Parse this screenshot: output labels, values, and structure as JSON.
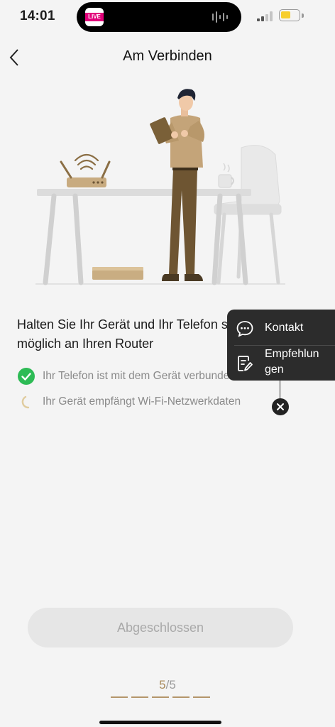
{
  "status_bar": {
    "time": "14:01",
    "island_app": "LIVE",
    "battery_color": "#f7ce2d"
  },
  "nav": {
    "back_icon": "chevron-left-icon",
    "title": "Am Verbinden"
  },
  "illustration": {
    "description_icon": "person-router-illustration"
  },
  "message": {
    "instruction": "Halten Sie Ihr Gerät und Ihr Telefon so nah wie möglich an Ihren Router",
    "steps": [
      {
        "label": "Ihr Telefon ist mit dem Gerät verbunden",
        "state": "done",
        "icon": "check-circle-icon"
      },
      {
        "label": "Ihr Gerät empfängt Wi-Fi-Netzwerkdaten",
        "state": "loading",
        "icon": "spinner-icon"
      }
    ]
  },
  "float_menu": {
    "items": [
      {
        "label": "Kontakt",
        "icon": "chat-bubble-icon"
      },
      {
        "label": "Empfehlungen",
        "label_lines": [
          "Empfehlun",
          "gen"
        ],
        "icon": "feedback-edit-icon"
      }
    ],
    "close_icon": "close-icon"
  },
  "actions": {
    "done_label": "Abgeschlossen"
  },
  "progress": {
    "current": "5",
    "separator": "/",
    "total": "5",
    "accent": "#b4956a"
  },
  "colors": {
    "background": "#f4f4f4",
    "check_green": "#2dbb55",
    "menu_bg": "#2c2c2c"
  }
}
